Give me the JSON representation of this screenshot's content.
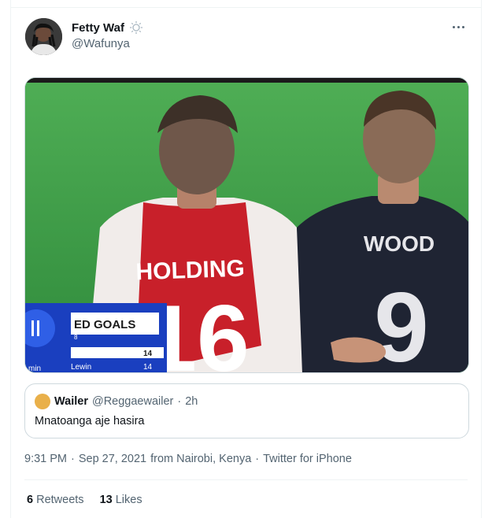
{
  "tweet": {
    "author_name": "Fetty Waf",
    "author_handle": "@Wafunya",
    "author_badge_icon": "sun-badge-icon",
    "more_icon": "ellipsis-icon",
    "media": {
      "jersey_left_name": "HOLDING",
      "jersey_left_number": "16",
      "jersey_right_name": "WOOD",
      "jersey_right_number": "9",
      "scoreboard_title": "ED GOALS",
      "scoreboard_row1": "14",
      "scoreboard_row2_name": "Lewin",
      "scoreboard_row2_value": "14",
      "scoreboard_sub": "8",
      "scoreboard_corner": "min"
    },
    "quote": {
      "name": "Wailer",
      "handle": "@Reggaewailer",
      "separator": "·",
      "time": "2h",
      "text": "Mnatoanga aje hasira"
    },
    "meta": {
      "time": "9:31 PM",
      "separator1": "·",
      "date": "Sep 27, 2021",
      "location": "from Nairobi, Kenya",
      "separator2": "·",
      "source": "Twitter for iPhone"
    },
    "stats": {
      "retweets_count": "6",
      "retweets_label": "Retweets",
      "likes_count": "13",
      "likes_label": "Likes"
    }
  },
  "colors": {
    "text_primary": "#0f1419",
    "text_secondary": "#536471",
    "border": "#cfd9de",
    "pitch_green": "#3f9a47",
    "arsenal_red": "#c8202a",
    "burnley_navy": "#1f2433"
  }
}
